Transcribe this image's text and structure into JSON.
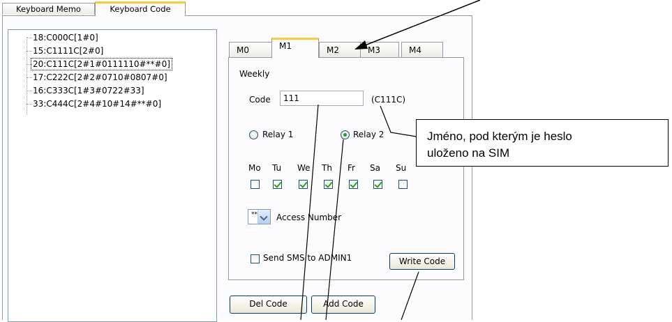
{
  "outer_tabs": [
    "Keyboard Memo",
    "Keyboard Code"
  ],
  "tree_items": [
    "18:C000C[1#0]",
    "15:C1111C[2#0]",
    "20:C111C[2#1#0111110#**#0]",
    "17:C222C[2#2#0710#0807#0]",
    "16:C333C[1#3#0722#33]",
    "33:C444C[2#4#10#14#**#0]"
  ],
  "inner_tabs": [
    "M0",
    "M1",
    "M2",
    "M3",
    "M4"
  ],
  "mode_label": "Weekly",
  "code": {
    "label": "Code",
    "value": "111",
    "name": "(C111C)"
  },
  "relays": {
    "relay1": "Relay 1",
    "relay2": "Relay 2",
    "selected": "Relay 2"
  },
  "days": [
    {
      "label": "Mo",
      "checked": false
    },
    {
      "label": "Tu",
      "checked": true
    },
    {
      "label": "We",
      "checked": true
    },
    {
      "label": "Th",
      "checked": true
    },
    {
      "label": "Fr",
      "checked": true
    },
    {
      "label": "Sa",
      "checked": true
    },
    {
      "label": "Su",
      "checked": false
    }
  ],
  "access": {
    "value": "**",
    "label": "Access Number"
  },
  "send_sms": {
    "label": "Send SMS to ADMIN1",
    "checked": false
  },
  "buttons": {
    "write": "Write Code",
    "del": "Del Code",
    "add": "Add Code"
  },
  "callout": {
    "line1": "Jméno, pod kterým je heslo",
    "line2": "uloženo na SIM"
  },
  "colors": {
    "accent_tab": "#ffc83c",
    "check": "#21a121",
    "border": "#919b9c"
  }
}
